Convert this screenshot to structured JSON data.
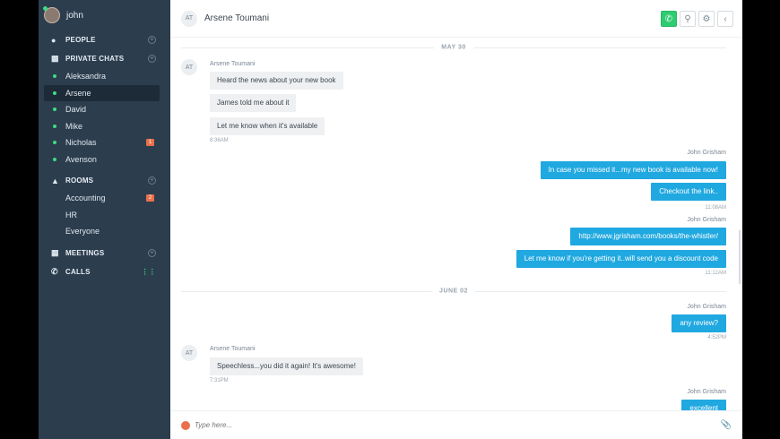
{
  "user": {
    "name": "john"
  },
  "sidebar": {
    "people_label": "PEOPLE",
    "private_chats_label": "PRIVATE CHATS",
    "chats": [
      {
        "name": "Aleksandra",
        "badge": ""
      },
      {
        "name": "Arsene",
        "badge": ""
      },
      {
        "name": "David",
        "badge": ""
      },
      {
        "name": "Mike",
        "badge": ""
      },
      {
        "name": "Nicholas",
        "badge": "1"
      },
      {
        "name": "Avenson",
        "badge": ""
      }
    ],
    "rooms_label": "ROOMS",
    "rooms": [
      {
        "name": "Accounting",
        "badge": "2"
      },
      {
        "name": "HR",
        "badge": ""
      },
      {
        "name": "Everyone",
        "badge": ""
      }
    ],
    "meetings_label": "MEETINGS",
    "calls_label": "CALLS"
  },
  "header": {
    "initials": "AT",
    "name": "Arsene Toumani"
  },
  "messages": {
    "day1": "MAY 30",
    "in_sender_1": "Arsene Toumani",
    "in_1": "Heard the news about your new book",
    "in_2": "James told me about it",
    "in_3": "Let me know when it's available",
    "in_time_1": "8:36AM",
    "out_sender_1": "John Grisham",
    "out_1": "In case you missed it...my new book is available now!",
    "out_2": "Checkout the link..",
    "out_time_1": "11:08AM",
    "out_sender_2": "John Grisham",
    "out_3": "http://www.jgrisham.com/books/the-whistler/",
    "out_4": "Let me know if you're getting it..will send you a discount code",
    "out_time_2": "11:12AM",
    "day2": "JUNE 02",
    "out_sender_3": "John Grisham",
    "out_5": "any review?",
    "out_time_3": "4:52PM",
    "in_sender_2": "Arsene Toumani",
    "in_4": "Speechless...you did it again! It's awesome!",
    "in_time_2": "7:31PM",
    "out_sender_4": "John Grisham",
    "out_6": "excellent"
  },
  "composer": {
    "placeholder": "Type here..."
  },
  "colors": {
    "sidebar": "#2c3d4e",
    "accent": "#20a8e0",
    "online": "#3ddc84",
    "badge": "#e8704a",
    "call": "#2ecc71"
  },
  "icons": {
    "people": "user-icon",
    "private_chats": "chat-bubbles-icon",
    "rooms": "group-icon",
    "meetings": "calendar-icon",
    "calls": "phone-icon"
  }
}
